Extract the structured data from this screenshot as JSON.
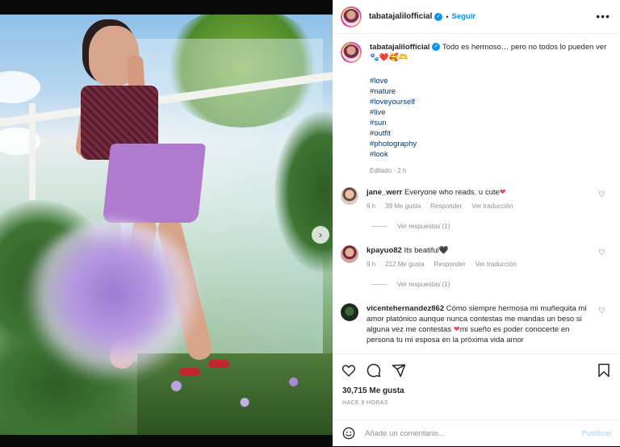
{
  "post": {
    "username": "tabatajalilofficial",
    "separator": "•",
    "follow_label": "Seguir",
    "more_label": "•••"
  },
  "caption": {
    "username": "tabatajalilofficial",
    "text": "Todo es hermoso… pero no todos lo pueden ver 🐾❤️🥰🫶",
    "hashtags": [
      "#love",
      "#nature",
      "#loveyourself",
      "#live",
      "#sun",
      "#outfit",
      "#photography",
      "#look"
    ],
    "edited": "Editado · 2 h"
  },
  "comments": [
    {
      "username": "jane_werr",
      "text": "Everyone who reads. u cute",
      "emoji": "❤",
      "time": "9 h",
      "likes": "39 Me gusta",
      "reply": "Responder",
      "translate": "Ver traducción",
      "replies": "Ver respuestas (1)"
    },
    {
      "username": "kpayuo82",
      "text": "Its beatiful",
      "emoji": "🖤",
      "time": "9 h",
      "likes": "212 Me gusta",
      "reply": "Responder",
      "translate": "Ver traducción",
      "replies": "Ver respuestas (1)"
    },
    {
      "username": "vicentehernandez862",
      "text_before": "Cómo siempre hermosa mi muñequita mi amor platónico aunque nunca contestas me mandas un beso si alguna vez me contestas",
      "emoji": "❤",
      "text_after": "mi sueño es poder conocerte en persona tu mi esposa en la próxima vida amor"
    }
  ],
  "actions": {
    "likes": "30,715 Me gusta",
    "time_ago": "HACE 9 HORAS",
    "comment_placeholder": "Añade un comentario...",
    "publish_label": "Publicar"
  },
  "carousel": {
    "next_label": "›",
    "dot_count": 5,
    "active_dot": 0
  },
  "colors": {
    "accent": "#0095f6",
    "heart": "#ed4956",
    "muted": "#8e8e8e",
    "skirt": "#b07bcf"
  },
  "icons": [
    "more-options-icon",
    "verified-icon",
    "heart-icon",
    "comment-icon",
    "share-icon",
    "bookmark-icon",
    "emoji-icon",
    "chevron-right-icon"
  ]
}
